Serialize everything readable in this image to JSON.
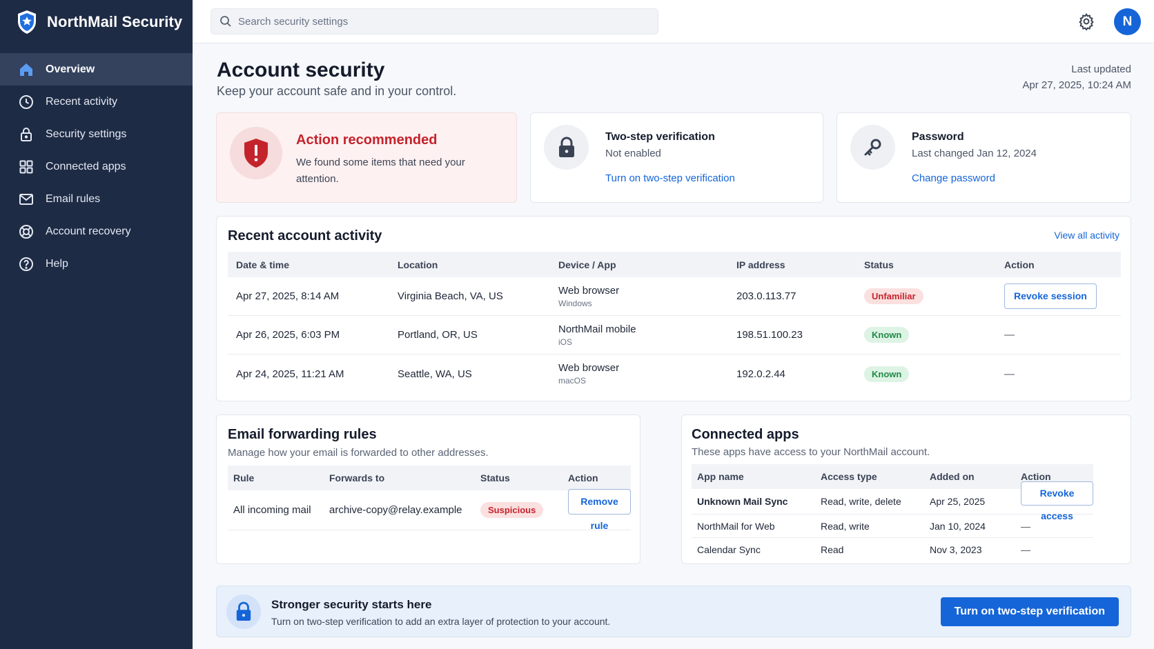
{
  "brand": {
    "name": "NorthMail Security",
    "icon": "shield-check-icon"
  },
  "sidebar": {
    "items": [
      {
        "label": "Overview",
        "icon": "home-icon",
        "active": true
      },
      {
        "label": "Recent activity",
        "icon": "clock-icon"
      },
      {
        "label": "Security settings",
        "icon": "lock-icon"
      },
      {
        "label": "Connected apps",
        "icon": "grid-icon"
      },
      {
        "label": "Email rules",
        "icon": "mail-icon"
      },
      {
        "label": "Account recovery",
        "icon": "lifebuoy-icon"
      },
      {
        "label": "Help",
        "icon": "help-circle-icon"
      }
    ]
  },
  "topbar": {
    "search_placeholder": "Search security settings",
    "avatar_initial": "N"
  },
  "header": {
    "title": "Account security",
    "subtitle": "Keep your account safe and in your control.",
    "updated_label": "Last updated",
    "updated_value": "Apr 27, 2025, 10:24 AM"
  },
  "alert": {
    "title": "Action recommended",
    "description": "We found some items that need your attention."
  },
  "two_step": {
    "title": "Two-step verification",
    "status": "Not enabled",
    "link": "Turn on two-step verification"
  },
  "password": {
    "title": "Password",
    "status": "Last changed Jan 12, 2024",
    "link": "Change password"
  },
  "activity": {
    "title": "Recent account activity",
    "view_all": "View all activity",
    "columns": [
      "Date & time",
      "Location",
      "Device / App",
      "IP address",
      "Status",
      "Action"
    ],
    "rows": [
      {
        "datetime": "Apr 27, 2025, 8:14 AM",
        "location": "Virginia Beach, VA, US",
        "device": "Web browser",
        "platform": "Windows",
        "ip": "203.0.113.77",
        "status": "Unfamiliar",
        "action": "Revoke session"
      },
      {
        "datetime": "Apr 26, 2025, 6:03 PM",
        "location": "Portland, OR, US",
        "device": "NorthMail mobile",
        "platform": "iOS",
        "ip": "198.51.100.23",
        "status": "Known",
        "action": "—"
      },
      {
        "datetime": "Apr 24, 2025, 11:21 AM",
        "location": "Seattle, WA, US",
        "device": "Web browser",
        "platform": "macOS",
        "ip": "192.0.2.44",
        "status": "Known",
        "action": "—"
      }
    ]
  },
  "forwarding": {
    "title": "Email forwarding rules",
    "subtitle": "Manage how your email is forwarded to other addresses.",
    "columns": [
      "Rule",
      "Forwards to",
      "Status",
      "Action"
    ],
    "rows": [
      {
        "rule": "All incoming mail",
        "forwards_to": "archive-copy@relay.example",
        "status": "Suspicious",
        "action": "Remove rule"
      }
    ]
  },
  "apps": {
    "title": "Connected apps",
    "subtitle": "These apps have access to your NorthMail account.",
    "columns": [
      "App name",
      "Access type",
      "Added on",
      "Action"
    ],
    "rows": [
      {
        "name": "Unknown Mail Sync",
        "access": "Read, write, delete",
        "added": "Apr 25, 2025",
        "action": "Revoke access"
      },
      {
        "name": "NorthMail for Web",
        "access": "Read, write",
        "added": "Jan 10, 2024",
        "action": "—"
      },
      {
        "name": "Calendar Sync",
        "access": "Read",
        "added": "Nov 3, 2023",
        "action": "—"
      }
    ]
  },
  "banner": {
    "title": "Stronger security starts here",
    "description": "Turn on two-step verification to add an extra layer of protection to your account.",
    "button": "Turn on two-step verification"
  },
  "colors": {
    "sidebar_bg": "#1e2b45",
    "accent": "#1565d8",
    "danger": "#c4232b",
    "success": "#1f8a46"
  }
}
